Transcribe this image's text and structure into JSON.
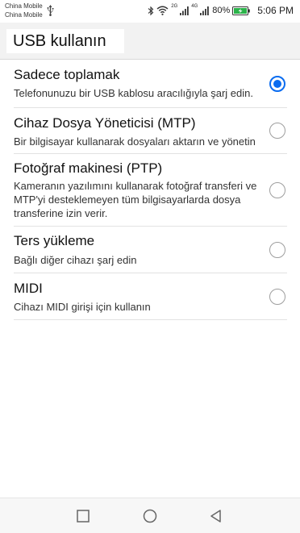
{
  "status_bar": {
    "carrier_1": "China Mobile",
    "carrier_2": "China Mobile",
    "network_1": "2G",
    "network_2": "4G",
    "battery_percent": "80%",
    "time": "5:06 PM",
    "icons": [
      "usb-icon",
      "bluetooth-icon",
      "wifi-icon",
      "signal-icon",
      "battery-charging-icon"
    ]
  },
  "header": {
    "title": "USB kullanın"
  },
  "options": [
    {
      "title": "Sadece toplamak",
      "description": "Telefonunuzu bir USB kablosu aracılığıyla şarj edin.",
      "selected": true
    },
    {
      "title": "Cihaz Dosya Yöneticisi (MTP)",
      "description": "Bir bilgisayar kullanarak dosyaları aktarın ve yönetin",
      "selected": false
    },
    {
      "title": "Fotoğraf makinesi (PTP)",
      "description": "Kameranın yazılımını kullanarak fotoğraf transferi ve MTP'yi desteklemeyen tüm bilgisayarlarda dosya transferine izin verir.",
      "selected": false
    },
    {
      "title": "Ters yükleme",
      "description": "Bağlı diğer cihazı şarj edin",
      "selected": false
    },
    {
      "title": "MIDI",
      "description": "Cihazı MIDI girişi için kullanın",
      "selected": false
    }
  ],
  "colors": {
    "accent": "#0a6cf0",
    "radio_unchecked": "#9e9e9e",
    "battery": "#2bb34a"
  },
  "nav_bar": {
    "icons": [
      "recents-square-icon",
      "home-circle-icon",
      "back-triangle-icon"
    ]
  }
}
